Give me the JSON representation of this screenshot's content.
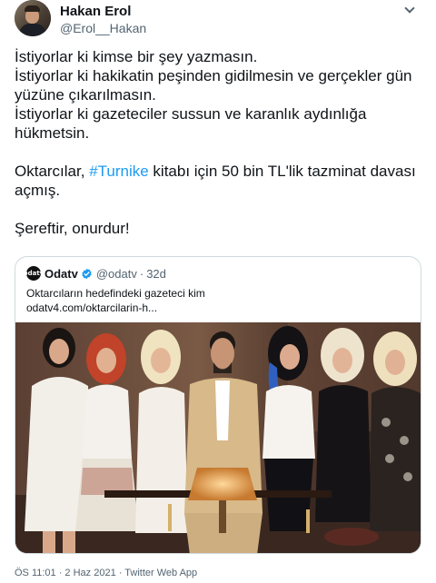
{
  "author": {
    "display_name": "Hakan Erol",
    "handle": "@Erol__Hakan"
  },
  "tweet": {
    "lines": [
      "İstiyorlar ki kimse bir şey yazmasın.",
      "İstiyorlar ki hakikatin peşinden gidilmesin ve gerçekler gün yüzüne çıkarılmasın.",
      "İstiyorlar ki gazeteciler sussun ve karanlık aydınlığa hükmetsin."
    ],
    "para2_before": "Oktarcılar, ",
    "hashtag": "#Turnike",
    "para2_after": " kitabı için 50 bin TL'lik tazminat davası açmış.",
    "para3": "Şereftir, onurdur!"
  },
  "quote": {
    "avatar_text": "odatv",
    "name": "Odatv",
    "handle": "@odatv",
    "separator": "·",
    "time": "32d",
    "text": "Oktarcıların hedefindeki gazeteci kim",
    "link": "odatv4.com/oktarcilarin-h..."
  },
  "footer": {
    "timestamp": "ÖS 11:01 · 2 Haz 2021 · Twitter Web App"
  },
  "colors": {
    "link": "#1d9bf0",
    "secondary_text": "#536471",
    "border": "#cfd9de"
  }
}
